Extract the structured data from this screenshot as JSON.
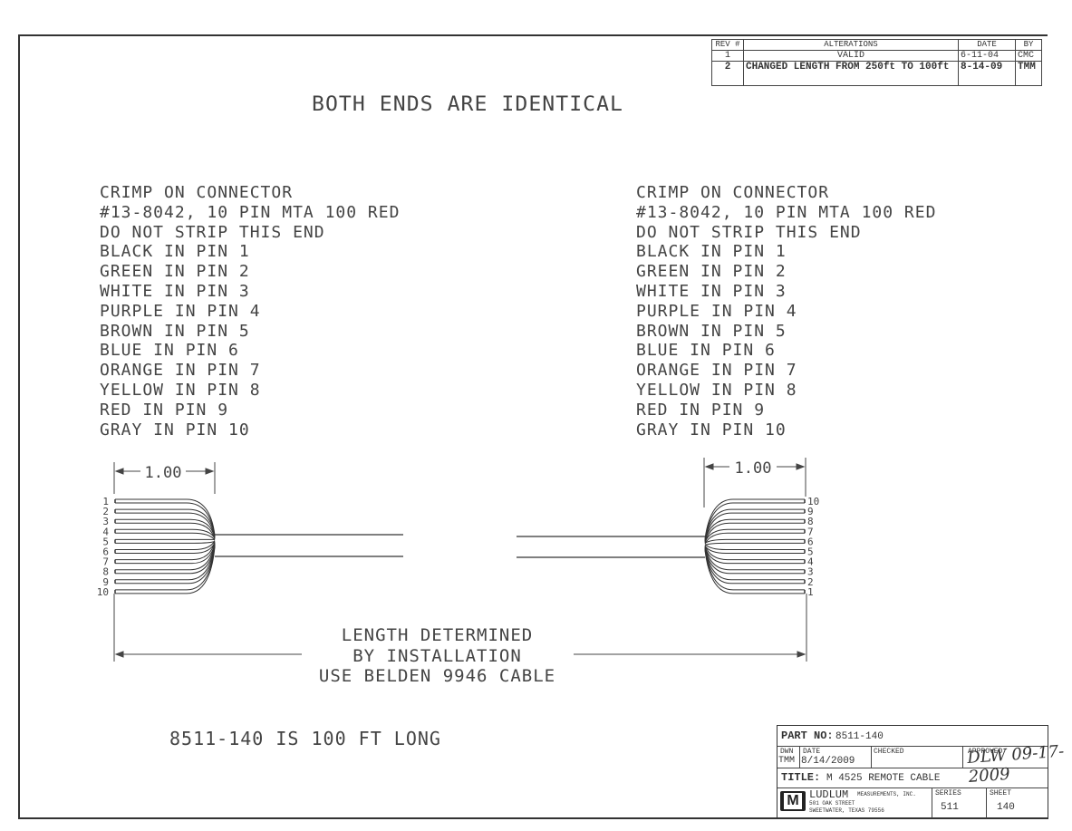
{
  "heading": "BOTH ENDS ARE IDENTICAL",
  "revision_table": {
    "headers": [
      "REV #",
      "ALTERATIONS",
      "DATE",
      "BY"
    ],
    "rows": [
      {
        "rev": "1",
        "alteration": "VALID",
        "date": "6-11-04",
        "by": "CMC"
      },
      {
        "rev": "2",
        "alteration": "CHANGED LENGTH FROM 250ft TO 100ft",
        "date": "8-14-09",
        "by": "TMM"
      }
    ]
  },
  "connector_notes": {
    "left": [
      "CRIMP ON CONNECTOR",
      "#13-8042, 10 PIN MTA 100 RED",
      "DO NOT STRIP THIS END",
      "BLACK IN PIN 1",
      "GREEN IN PIN 2",
      "WHITE IN PIN 3",
      "PURPLE IN PIN 4",
      "BROWN IN PIN 5",
      "BLUE IN PIN 6",
      "ORANGE IN PIN 7",
      "YELLOW IN PIN 8",
      "RED IN PIN 9",
      "GRAY IN PIN 10"
    ],
    "right": [
      "CRIMP ON CONNECTOR",
      "#13-8042, 10 PIN MTA 100 RED",
      "DO NOT STRIP THIS END",
      "BLACK IN PIN 1",
      "GREEN IN PIN 2",
      "WHITE IN PIN 3",
      "PURPLE IN PIN 4",
      "BROWN IN PIN 5",
      "BLUE IN PIN 6",
      "ORANGE IN PIN 7",
      "YELLOW IN PIN 8",
      "RED IN PIN 9",
      "GRAY IN PIN 10"
    ]
  },
  "dimensions": {
    "left_strip_length": "1.00",
    "right_strip_length": "1.00"
  },
  "pins": {
    "left": [
      "1",
      "2",
      "3",
      "4",
      "5",
      "6",
      "7",
      "8",
      "9",
      "10"
    ],
    "right": [
      "10",
      "9",
      "8",
      "7",
      "6",
      "5",
      "4",
      "3",
      "2",
      "1"
    ]
  },
  "length_note": [
    "LENGTH DETERMINED",
    "BY INSTALLATION",
    "USE BELDEN 9946 CABLE"
  ],
  "cable_length_note": "8511-140 IS 100 FT LONG",
  "title_block": {
    "part_no_label": "PART NO:",
    "part_no": "8511-140",
    "dwn_label": "DWN",
    "dwn": "TMM",
    "date_label": "DATE",
    "date": "8/14/2009",
    "checked_label": "CHECKED",
    "approved_label": "APPROVED",
    "approved_signature": "DLW 09-17-2009",
    "title_label": "TITLE:",
    "title": "M 4525 REMOTE CABLE",
    "company": "LUDLUM",
    "company_suffix": "MEASUREMENTS, INC.",
    "address1": "501 OAK STREET",
    "address2": "SWEETWATER, TEXAS 79556",
    "logo_letter": "M",
    "series_label": "SERIES",
    "series": "511",
    "sheet_label": "SHEET",
    "sheet": "140"
  }
}
